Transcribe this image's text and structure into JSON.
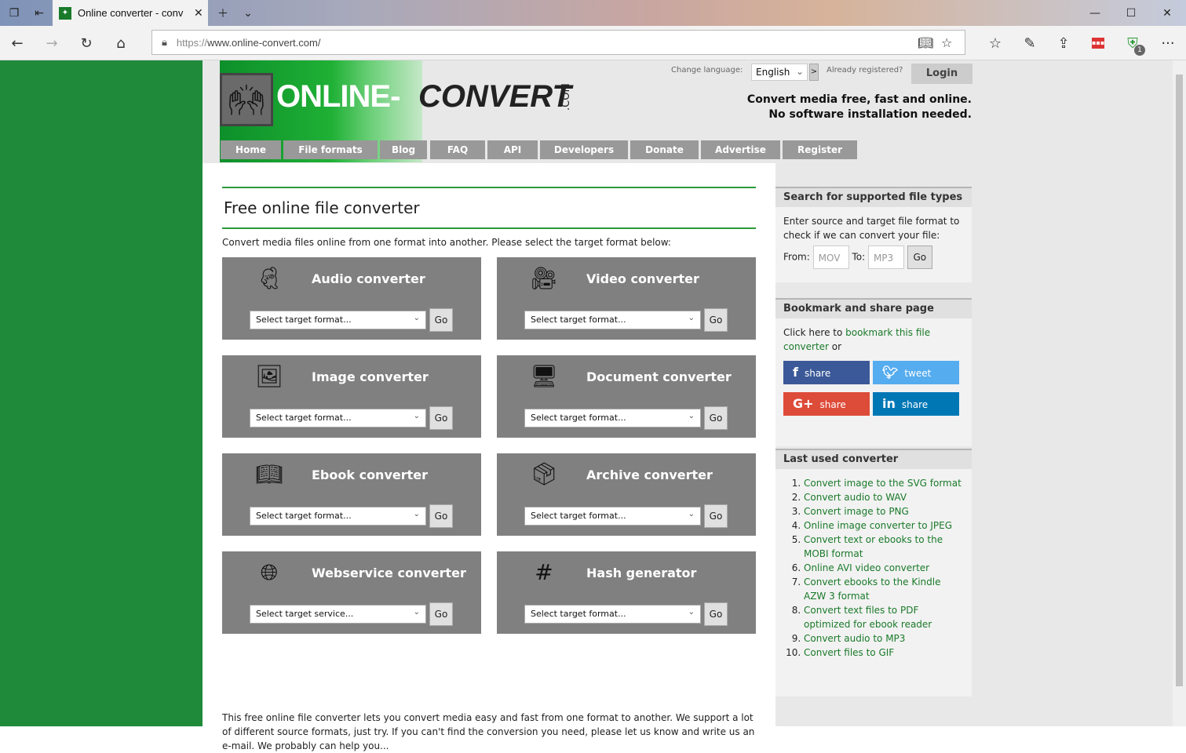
{
  "browser": {
    "tab_title": "Online converter - conv",
    "url_scheme": "https://",
    "url_host": "www.online-convert.com/",
    "extension_badge": "1"
  },
  "header": {
    "logo_main": "ONLINE-",
    "logo_conv": "CONVERT",
    "logo_com": ".COM",
    "change_language_label": "Change language:",
    "language_value": "English",
    "language_go": ">",
    "already_registered": "Already registered?",
    "login": "Login",
    "tagline_1": "Convert media free, fast and online.",
    "tagline_2": "No software installation needed."
  },
  "menu": [
    "Home",
    "File formats",
    "Blog",
    "FAQ",
    "API",
    "Developers",
    "Donate",
    "Advertise",
    "Register"
  ],
  "main": {
    "title": "Free online file converter",
    "intro": "Convert media files online from one format into another. Please select the target format below:",
    "cards": [
      {
        "title": "Audio converter",
        "select": "Select target format...",
        "go": "Go",
        "icon": "audio-icon"
      },
      {
        "title": "Video converter",
        "select": "Select target format...",
        "go": "Go",
        "icon": "video-icon"
      },
      {
        "title": "Image converter",
        "select": "Select target format...",
        "go": "Go",
        "icon": "image-icon"
      },
      {
        "title": "Document converter",
        "select": "Select target format...",
        "go": "Go",
        "icon": "document-icon"
      },
      {
        "title": "Ebook converter",
        "select": "Select target format...",
        "go": "Go",
        "icon": "ebook-icon"
      },
      {
        "title": "Archive converter",
        "select": "Select target format...",
        "go": "Go",
        "icon": "archive-icon"
      },
      {
        "title": "Webservice converter",
        "select": "Select target service...",
        "go": "Go",
        "icon": "webservice-icon"
      },
      {
        "title": "Hash generator",
        "select": "Select target format...",
        "go": "Go",
        "icon": "hash-icon"
      }
    ],
    "outro": "This free online file converter lets you convert media easy and fast from one format to another. We support a lot of different source formats, just try. If you can't find the conversion you need, please let us know and write us an e-mail. We probably can help you..."
  },
  "sidebar": {
    "search": {
      "heading": "Search for supported file types",
      "text": "Enter source and target file format to check if we can convert your file:",
      "from_label": "From:",
      "from_placeholder": "MOV",
      "to_label": "To:",
      "to_placeholder": "MP3",
      "go": "Go"
    },
    "bookmark": {
      "heading": "Bookmark and share page",
      "text_before": "Click here to ",
      "link": "bookmark this file converter",
      "text_after": " or",
      "facebook": "share",
      "twitter": "tweet",
      "google": "share",
      "linkedin": "share"
    },
    "last_used": {
      "heading": "Last used converter",
      "items": [
        "Convert image to the SVG format",
        "Convert audio to WAV",
        "Convert image to PNG",
        "Online image converter to JPEG",
        "Convert text or ebooks to the MOBI format",
        "Online AVI video converter",
        "Convert ebooks to the Kindle AZW 3 format",
        "Convert text files to PDF optimized for ebook reader",
        "Convert audio to MP3",
        "Convert files to GIF"
      ]
    }
  },
  "colors": {
    "green": "#1f8a3a",
    "link_green": "#1a7a2a",
    "card_grey": "#808080",
    "facebook": "#3b5998",
    "twitter": "#55acee",
    "google": "#dd4b39",
    "linkedin": "#0077b5"
  }
}
